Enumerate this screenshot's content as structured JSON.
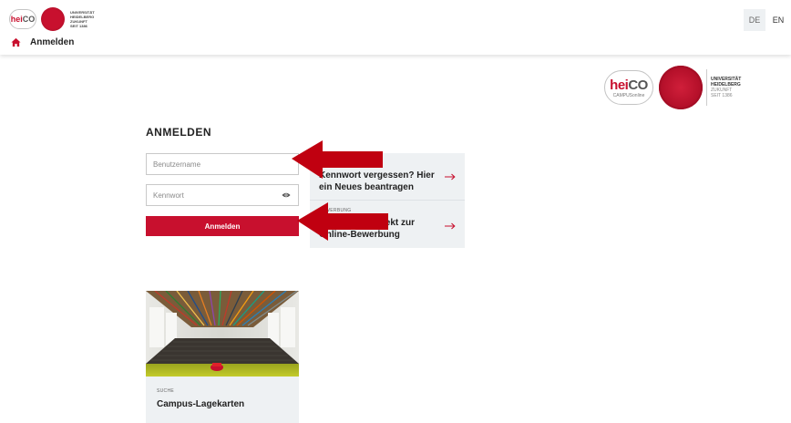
{
  "header": {
    "logo_small": {
      "heico_he": "hei",
      "heico_co": "CO",
      "university": [
        "UNIVERSITÄT",
        "HEIDELBERG",
        "ZUKUNFT",
        "SEIT 1386"
      ]
    },
    "lang_de": "DE",
    "lang_en": "EN"
  },
  "breadcrumb": {
    "label": "Anmelden"
  },
  "logo_large": {
    "heico_he": "hei",
    "heico_co": "CO",
    "campus_online": "CAMPUSonline",
    "university": [
      "UNIVERSITÄT",
      "HEIDELBERG",
      "ZUKUNFT",
      "SEIT 1386"
    ]
  },
  "login": {
    "title": "ANMELDEN",
    "username_placeholder": "Benutzername",
    "password_placeholder": "Kennwort",
    "submit_label": "Anmelden"
  },
  "panels": {
    "forgot_password": "Kennwort vergessen? Hier ein Neues beantragen",
    "application_small": "BEWERBUNG",
    "application_text": "Hier geht es direkt zur Online-Bewerbung"
  },
  "card": {
    "small": "SUCHE",
    "title": "Campus-Lagekarten"
  },
  "colors": {
    "brand_red": "#c8102e",
    "panel_bg": "#eef1f3",
    "annotation_arrow": "#c00010"
  }
}
